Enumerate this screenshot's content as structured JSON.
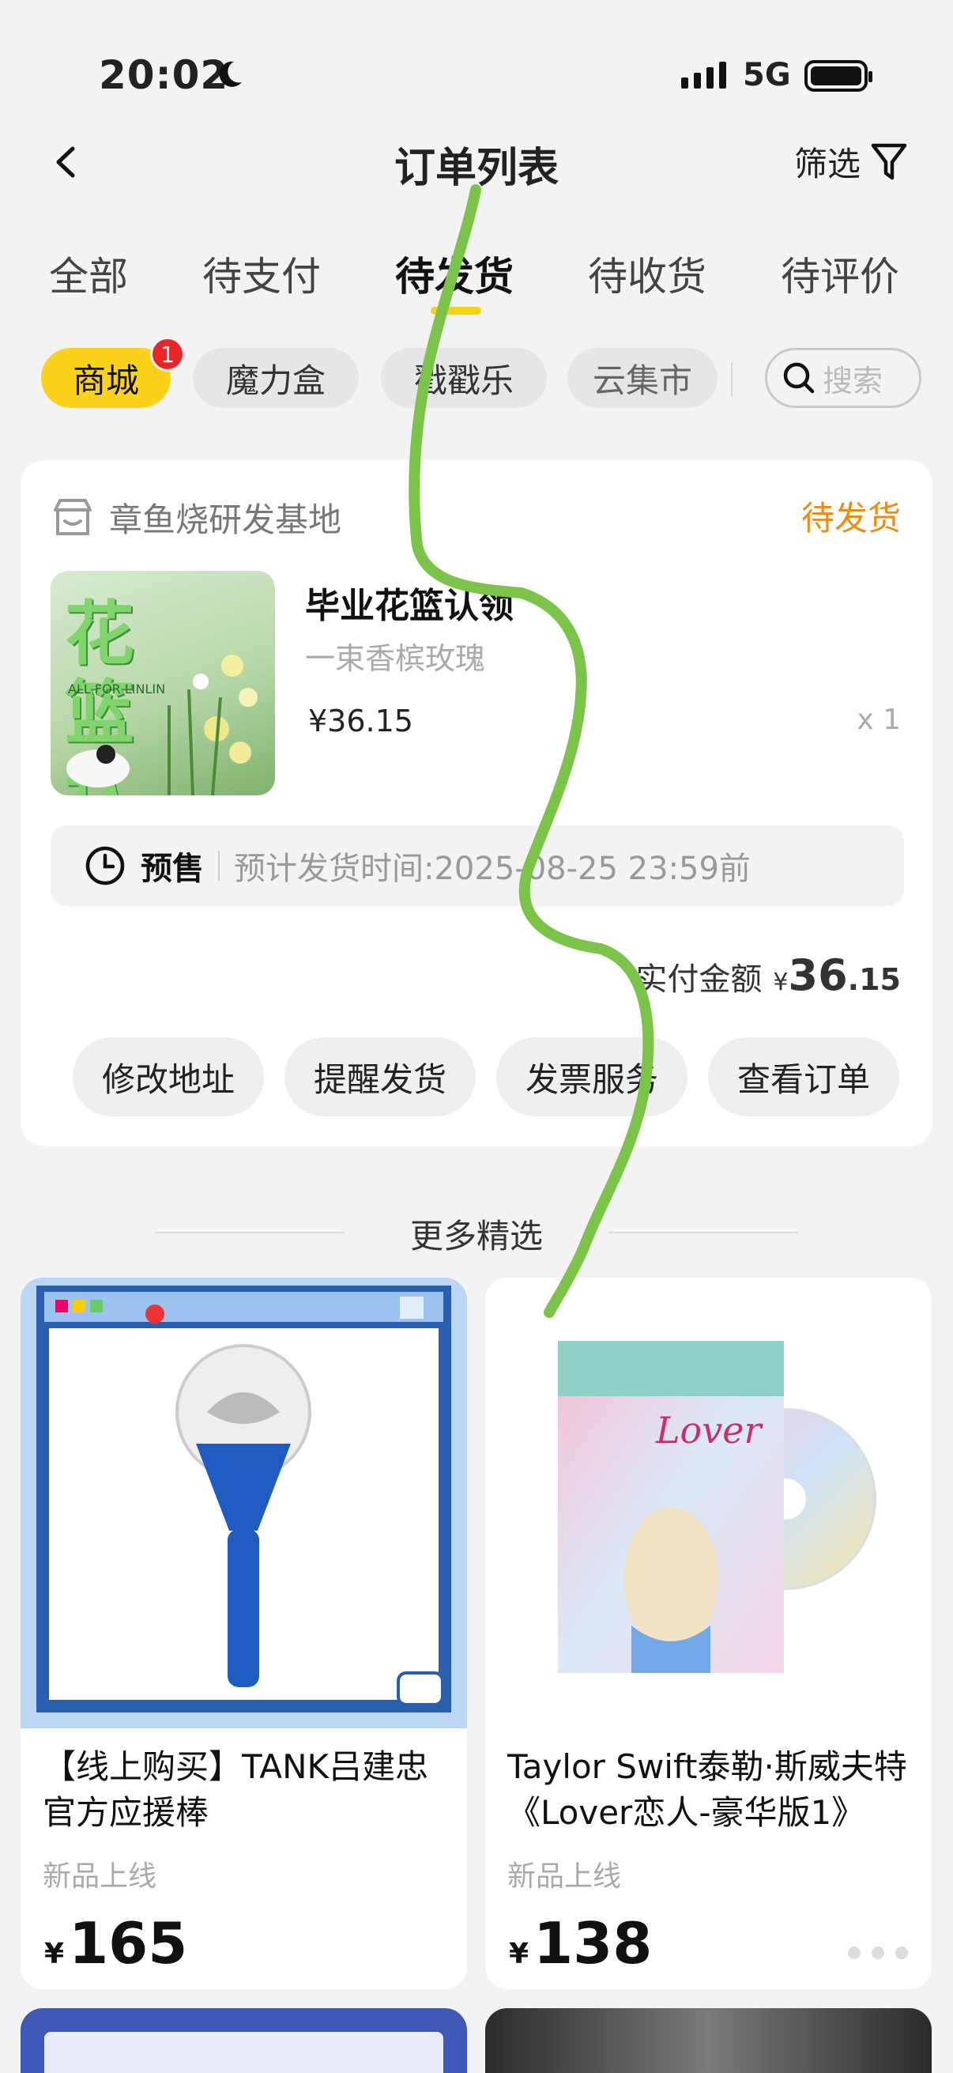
{
  "status_bar": {
    "time": "20:02",
    "network": "5G"
  },
  "nav": {
    "title": "订单列表",
    "filter_label": "筛选"
  },
  "tabs": [
    {
      "label": "全部"
    },
    {
      "label": "待支付"
    },
    {
      "label": "待发货",
      "active": true
    },
    {
      "label": "待收货"
    },
    {
      "label": "待评价"
    }
  ],
  "chips": [
    {
      "label": "商城",
      "active": true,
      "badge": "1"
    },
    {
      "label": "魔力盒"
    },
    {
      "label": "戳戳乐"
    },
    {
      "label": "云集市"
    }
  ],
  "search": {
    "placeholder": "搜索"
  },
  "order": {
    "shop_name": "章鱼烧研发基地",
    "status": "待发货",
    "product_name": "毕业花篮认领",
    "thumb_text": "花篮认领",
    "thumb_sub": "ALL FOR LINLIN",
    "spec": "一束香槟玫瑰",
    "price": "¥36.15",
    "qty": "x 1",
    "presale_tag": "预售",
    "presale_eta": "预计发货时间:2025-08-25 23:59前",
    "paid_label": "实付金额",
    "paid_yen": "¥",
    "paid_int": "36",
    "paid_dec": ".15",
    "actions": [
      "修改地址",
      "提醒发货",
      "发票服务",
      "查看订单"
    ]
  },
  "more_title": "更多精选",
  "products": [
    {
      "title": "【线上购买】TANK吕建忠官方应援棒",
      "tag": "新品上线",
      "yen": "¥",
      "price": "165"
    },
    {
      "title": "Taylor Swift泰勒·斯威夫特《Lover恋人-豪华版1》",
      "tag": "新品上线",
      "yen": "¥",
      "price": "138",
      "album_text": "Lover"
    }
  ],
  "colors": {
    "accent_yellow": "#fbd21b",
    "status_orange": "#ef8a12",
    "badge_red": "#e8262a",
    "scribble_green": "#7cc34a"
  }
}
